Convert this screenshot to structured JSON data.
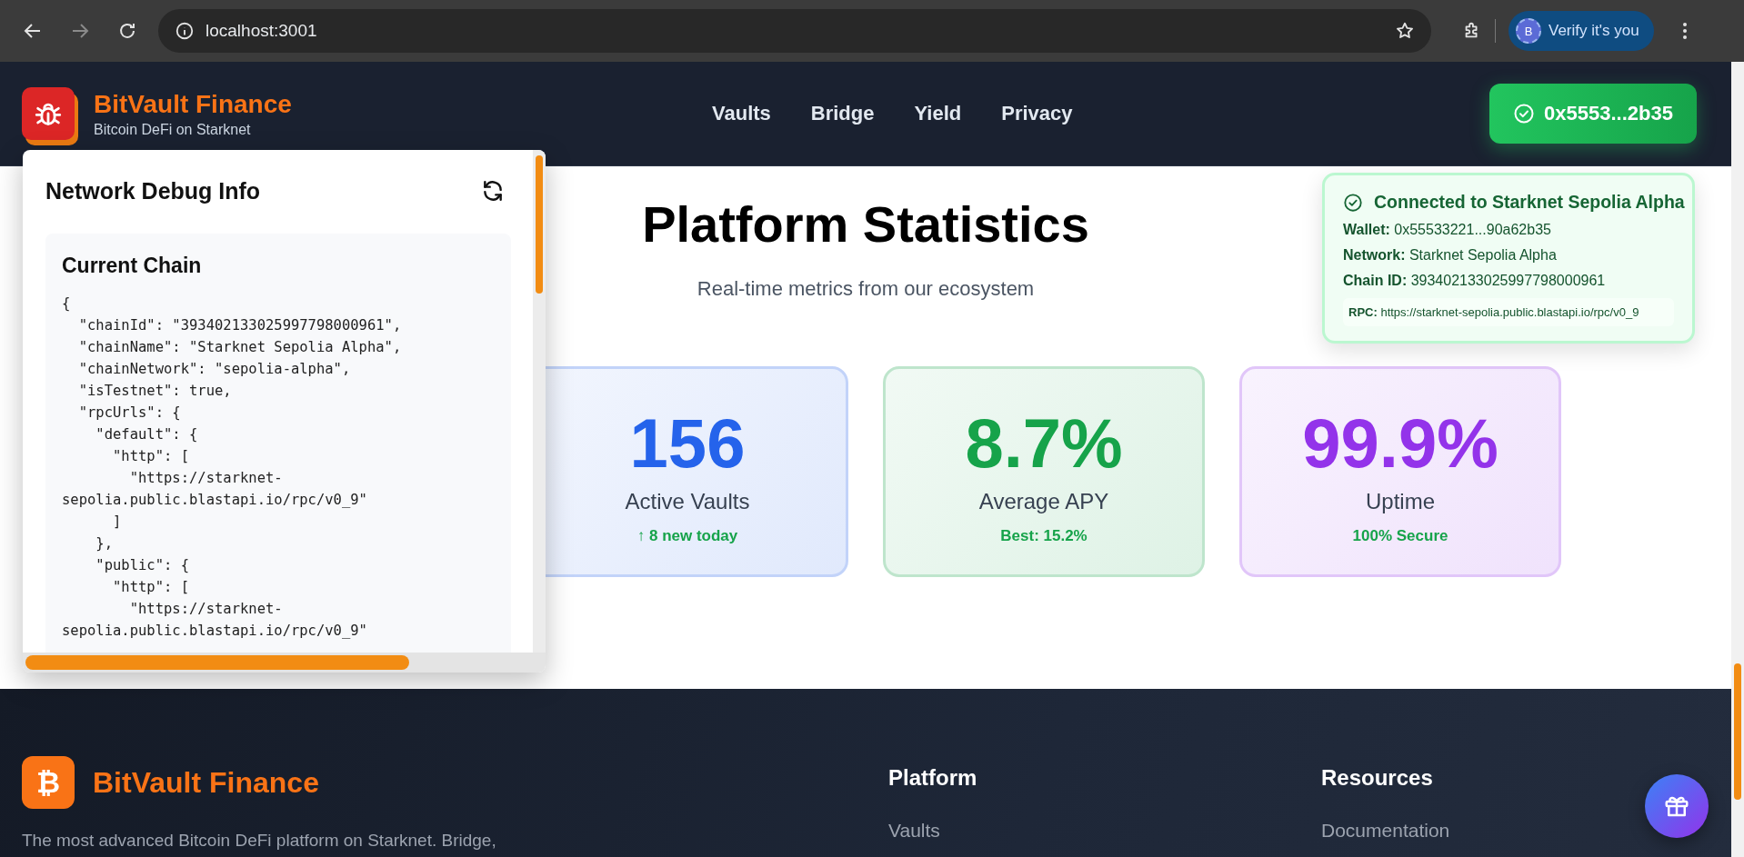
{
  "browser": {
    "url": "localhost:3001",
    "profile_initial": "B",
    "profile_button": "Verify it's you"
  },
  "header": {
    "brand": "BitVault Finance",
    "tagline": "Bitcoin DeFi on Starknet",
    "nav": [
      "Vaults",
      "Bridge",
      "Yield",
      "Privacy"
    ],
    "wallet_button": "0x5553...2b35"
  },
  "debug_panel": {
    "title": "Network Debug Info",
    "section_title": "Current Chain",
    "code_lines": [
      "{",
      "  \"chainId\": \"393402133025997798000961\",",
      "  \"chainName\": \"Starknet Sepolia Alpha\",",
      "  \"chainNetwork\": \"sepolia-alpha\",",
      "  \"isTestnet\": true,",
      "  \"rpcUrls\": {",
      "    \"default\": {",
      "      \"http\": [",
      "        \"https://starknet-",
      "sepolia.public.blastapi.io/rpc/v0_9\"",
      "      ]",
      "    },",
      "    \"public\": {",
      "      \"http\": [",
      "        \"https://starknet-",
      "sepolia.public.blastapi.io/rpc/v0_9\""
    ]
  },
  "stats": {
    "title": "Platform Statistics",
    "subtitle": "Real-time metrics from our ecosystem",
    "cards": [
      {
        "value": "156",
        "label": "Active Vaults",
        "note": "↑ 8 new today",
        "color": "#2563eb"
      },
      {
        "value": "8.7%",
        "label": "Average APY",
        "note": "Best: 15.2%",
        "color": "#16a34a"
      },
      {
        "value": "99.9%",
        "label": "Uptime",
        "note": "100% Secure",
        "color": "#9333ea"
      }
    ]
  },
  "connection_popup": {
    "title": "Connected to Starknet Sepolia Alpha",
    "fields": [
      {
        "label": "Wallet:",
        "value": "0x55533221...90a62b35"
      },
      {
        "label": "Network:",
        "value": "Starknet Sepolia Alpha"
      },
      {
        "label": "Chain ID:",
        "value": "393402133025997798000961"
      }
    ],
    "rpc": {
      "label": "RPC:",
      "value": "https://starknet-sepolia.public.blastapi.io/rpc/v0_9"
    }
  },
  "footer": {
    "logo_glyph": "₿",
    "brand": "BitVault Finance",
    "description": "The most advanced Bitcoin DeFi platform on Starknet. Bridge,",
    "columns": [
      {
        "heading": "Platform",
        "links": [
          "Vaults"
        ]
      },
      {
        "heading": "Resources",
        "links": [
          "Documentation"
        ]
      }
    ]
  }
}
